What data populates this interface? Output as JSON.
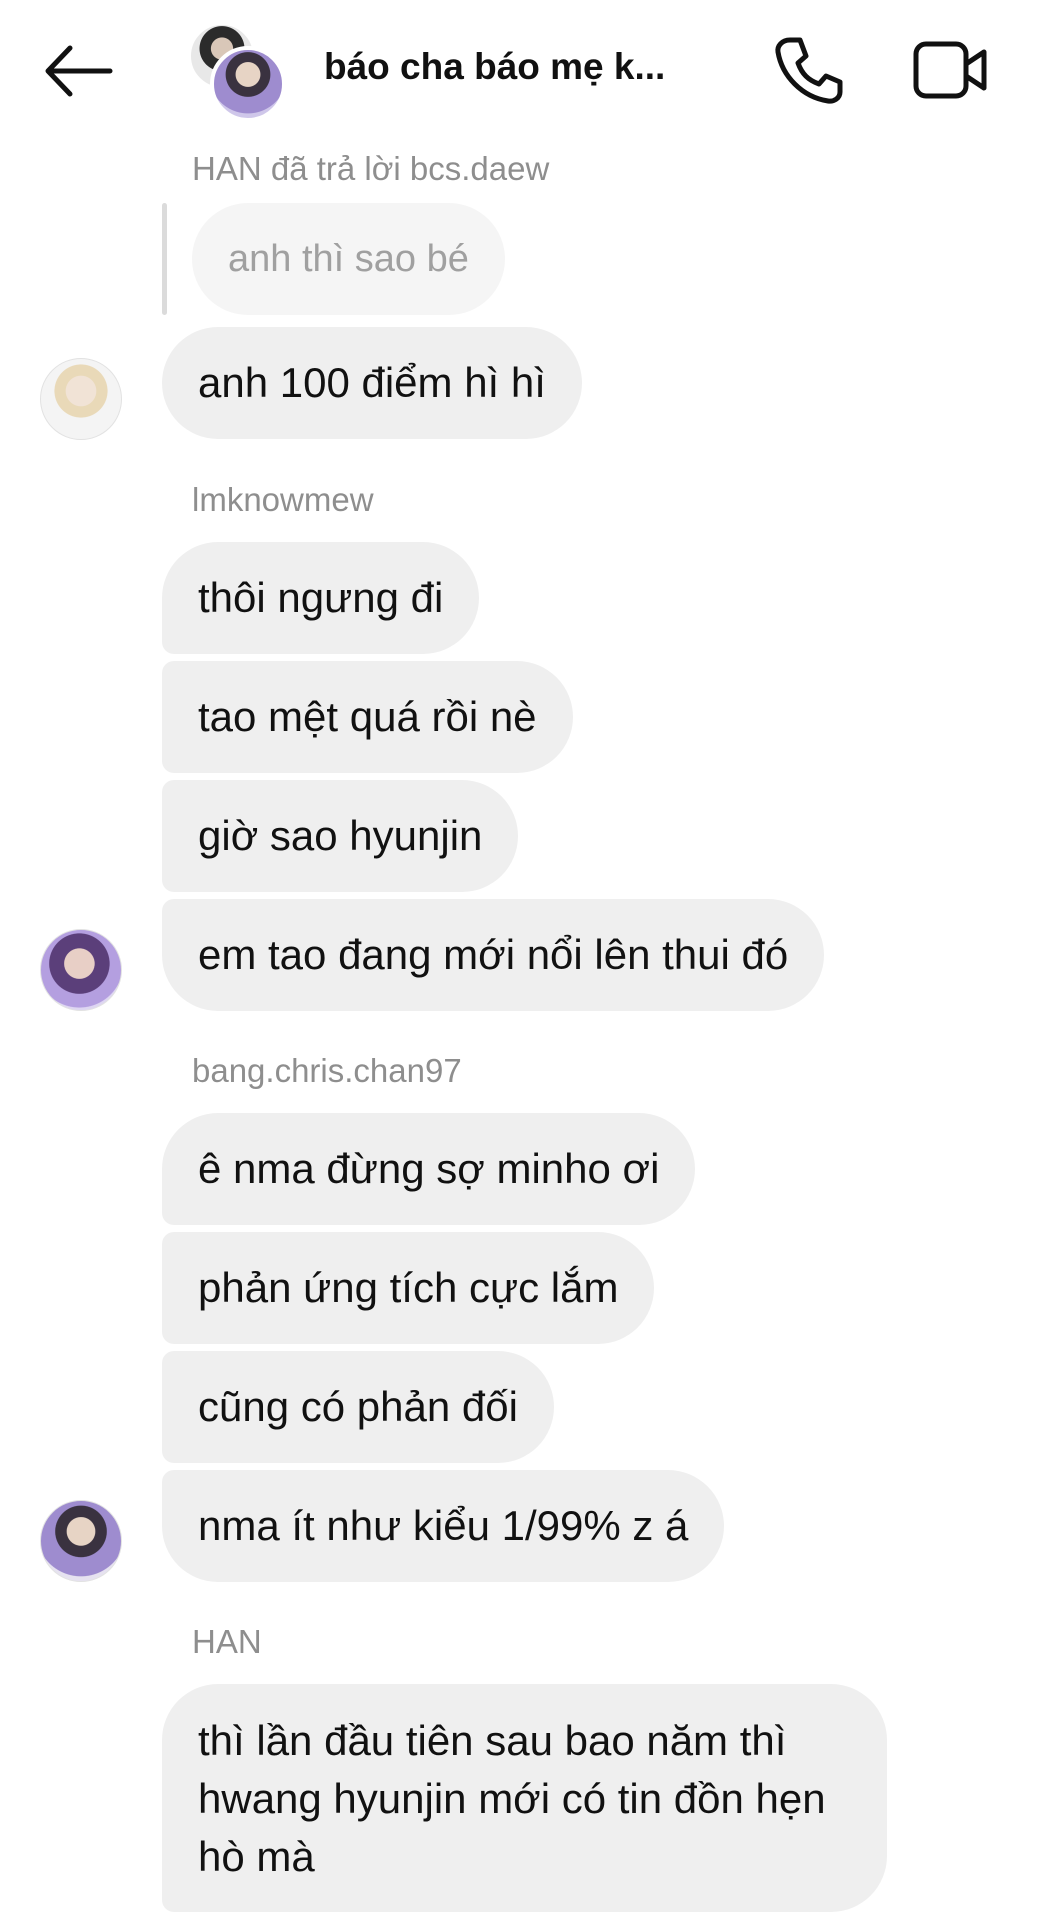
{
  "header": {
    "title": "báo cha báo mẹ k...",
    "back_icon": "arrow-left-icon",
    "call_icon": "phone-icon",
    "video_icon": "video-camera-icon"
  },
  "messages": {
    "reply_context": "HAN đã trả lời bcs.daew",
    "quoted_text": "anh thì sao bé",
    "group1": [
      "anh 100 điểm hì hì"
    ],
    "sender2": "lmknowmew",
    "group2": [
      "thôi ngưng đi",
      "tao mệt quá rồi nè",
      "giờ sao hyunjin",
      "em tao đang mới nổi lên thui đó"
    ],
    "sender3": "bang.chris.chan97",
    "group3": [
      "ê nma đừng sợ minho ơi",
      "phản ứng tích cực lắm",
      "cũng có phản đối",
      "nma ít như kiểu 1/99% z á"
    ],
    "sender4": "HAN",
    "group4": [
      "thì lần đầu tiên sau bao năm thì hwang hyunjin mới có tin đồn hẹn hò mà"
    ]
  },
  "colors": {
    "bubble": "#efefef",
    "quoted_bubble": "#f5f5f5",
    "meta_text": "#8e8e8e"
  }
}
